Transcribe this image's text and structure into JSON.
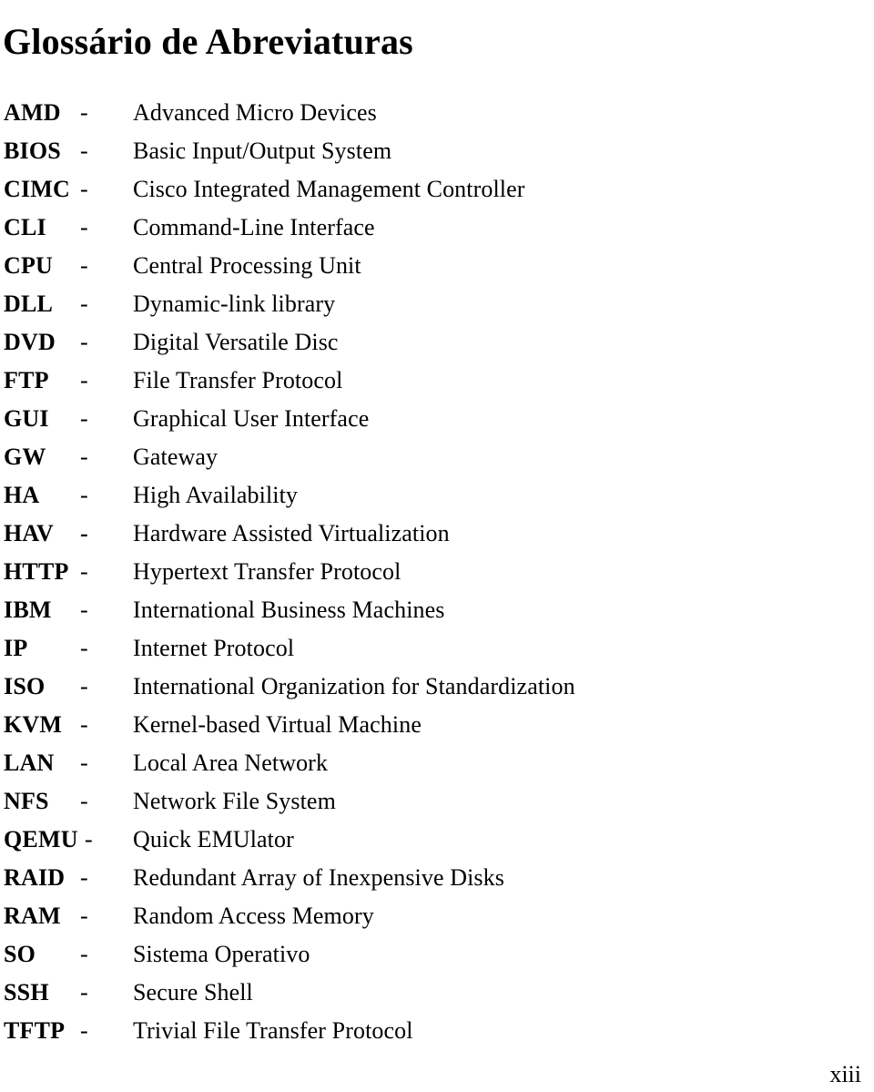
{
  "document": {
    "title": "Glossário de Abreviaturas",
    "page_number": "xiii"
  },
  "glossary": {
    "separator": "-",
    "entries": [
      {
        "abbr": "AMD",
        "sep": "-",
        "definition": "Advanced Micro Devices"
      },
      {
        "abbr": "BIOS",
        "sep": "-",
        "definition": "Basic Input/Output System"
      },
      {
        "abbr": "CIMC",
        "sep": "-",
        "definition": "Cisco Integrated Management Controller"
      },
      {
        "abbr": "CLI",
        "sep": "-",
        "definition": "Command-Line Interface"
      },
      {
        "abbr": "CPU",
        "sep": "-",
        "definition": "Central Processing Unit"
      },
      {
        "abbr": "DLL",
        "sep": "-",
        "definition": "Dynamic-link library"
      },
      {
        "abbr": "DVD",
        "sep": "-",
        "definition": "Digital Versatile Disc"
      },
      {
        "abbr": "FTP",
        "sep": "-",
        "definition": "File Transfer Protocol"
      },
      {
        "abbr": "GUI",
        "sep": "-",
        "definition": "Graphical User Interface"
      },
      {
        "abbr": "GW",
        "sep": "-",
        "definition": "Gateway"
      },
      {
        "abbr": "HA",
        "sep": "-",
        "definition": "High Availability"
      },
      {
        "abbr": "HAV",
        "sep": "-",
        "definition": "Hardware Assisted Virtualization"
      },
      {
        "abbr": "HTTP",
        "sep": "-",
        "definition": "Hypertext Transfer Protocol"
      },
      {
        "abbr": "IBM",
        "sep": "-",
        "definition": "International Business Machines"
      },
      {
        "abbr": "IP",
        "sep": "-",
        "definition": "Internet Protocol"
      },
      {
        "abbr": "ISO",
        "sep": "-",
        "definition": "International Organization for Standardization"
      },
      {
        "abbr": "KVM",
        "sep": "-",
        "definition": "Kernel-based Virtual Machine"
      },
      {
        "abbr": "LAN",
        "sep": "-",
        "definition": "Local Area Network"
      },
      {
        "abbr": "NFS",
        "sep": "-",
        "definition": "Network File System"
      },
      {
        "abbr": "QEMU",
        "sep": "-",
        "definition": "Quick EMUlator"
      },
      {
        "abbr": "RAID",
        "sep": "-",
        "definition": "Redundant Array of Inexpensive Disks"
      },
      {
        "abbr": "RAM",
        "sep": "-",
        "definition": "Random Access Memory"
      },
      {
        "abbr": "SO",
        "sep": "-",
        "definition": "Sistema Operativo"
      },
      {
        "abbr": "SSH",
        "sep": "-",
        "definition": "Secure Shell"
      },
      {
        "abbr": "TFTP",
        "sep": "-",
        "definition": "Trivial File Transfer Protocol"
      }
    ]
  }
}
